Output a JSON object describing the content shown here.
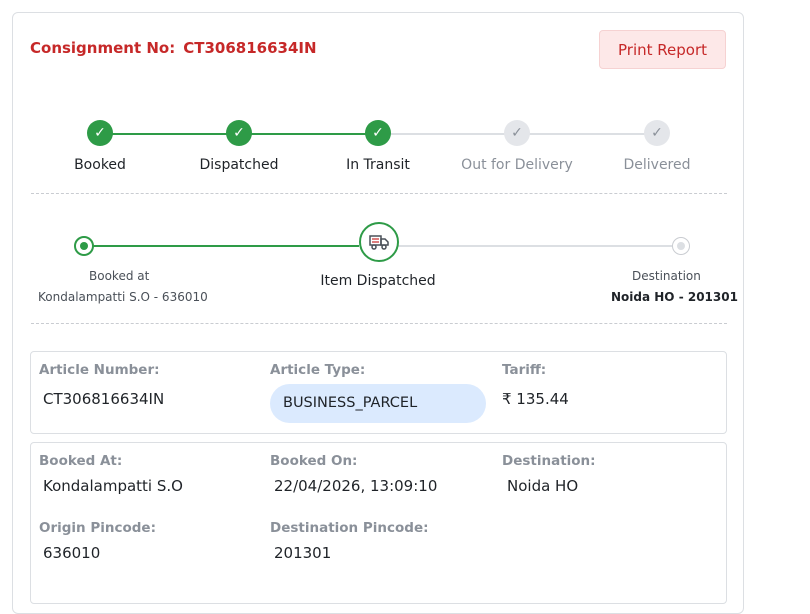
{
  "header": {
    "consignment_label": "Consignment No:",
    "consignment_number": "CT306816634IN",
    "print_button": "Print Report"
  },
  "status_steps": [
    {
      "label": "Booked",
      "state": "done"
    },
    {
      "label": "Dispatched",
      "state": "done"
    },
    {
      "label": "In Transit",
      "state": "done"
    },
    {
      "label": "Out for Delivery",
      "state": "pending"
    },
    {
      "label": "Delivered",
      "state": "pending"
    }
  ],
  "tracker": {
    "origin_caption": "Booked at",
    "origin_office": "Kondalampatti S.O - 636010",
    "current_status": "Item Dispatched",
    "destination_caption": "Destination",
    "destination_office": "Noida HO - 201301"
  },
  "article": {
    "number_label": "Article Number:",
    "number_value": "CT306816634IN",
    "type_label": "Article Type:",
    "type_value": "BUSINESS_PARCEL",
    "tariff_label": "Tariff:",
    "tariff_value": "₹ 135.44"
  },
  "booking": {
    "booked_at_label": "Booked At:",
    "booked_at_value": "Kondalampatti S.O",
    "booked_on_label": "Booked On:",
    "booked_on_value": "22/04/2026, 13:09:10",
    "destination_label": "Destination:",
    "destination_value": "Noida HO",
    "origin_pin_label": "Origin Pincode:",
    "origin_pin_value": "636010",
    "dest_pin_label": "Destination Pincode:",
    "dest_pin_value": "201301"
  },
  "icons": {
    "check": "check-icon",
    "truck": "truck-icon"
  },
  "colors": {
    "accent_red": "#c62828",
    "success_green": "#2e9b47",
    "pending_gray": "#e4e6ea",
    "type_pill_blue": "#dbeafe"
  }
}
